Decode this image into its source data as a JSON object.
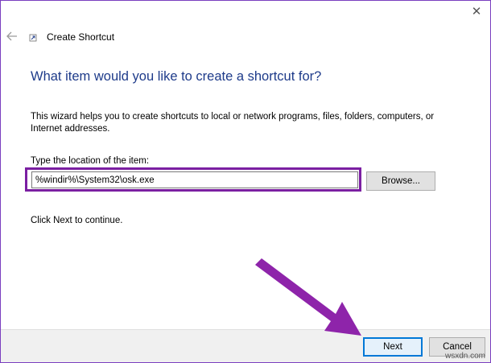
{
  "window": {
    "title": "Create Shortcut",
    "close_glyph": "✕",
    "back_glyph": "←"
  },
  "content": {
    "heading": "What item would you like to create a shortcut for?",
    "description": "This wizard helps you to create shortcuts to local or network programs, files, folders, computers, or Internet addresses.",
    "location_label": "Type the location of the item:",
    "location_value": "%windir%\\System32\\osk.exe",
    "browse_label": "Browse...",
    "continue_text": "Click Next to continue."
  },
  "footer": {
    "next_label": "Next",
    "cancel_label": "Cancel"
  },
  "annotation": {
    "highlight_color": "#7b1fa2",
    "arrow_color": "#8e24aa",
    "arrow_icon": "pointer-arrow"
  },
  "watermark": "wsxdn.com",
  "colors": {
    "heading": "#1e3b8a",
    "window_border": "#7a3fbf",
    "default_button_border": "#0078d7"
  }
}
